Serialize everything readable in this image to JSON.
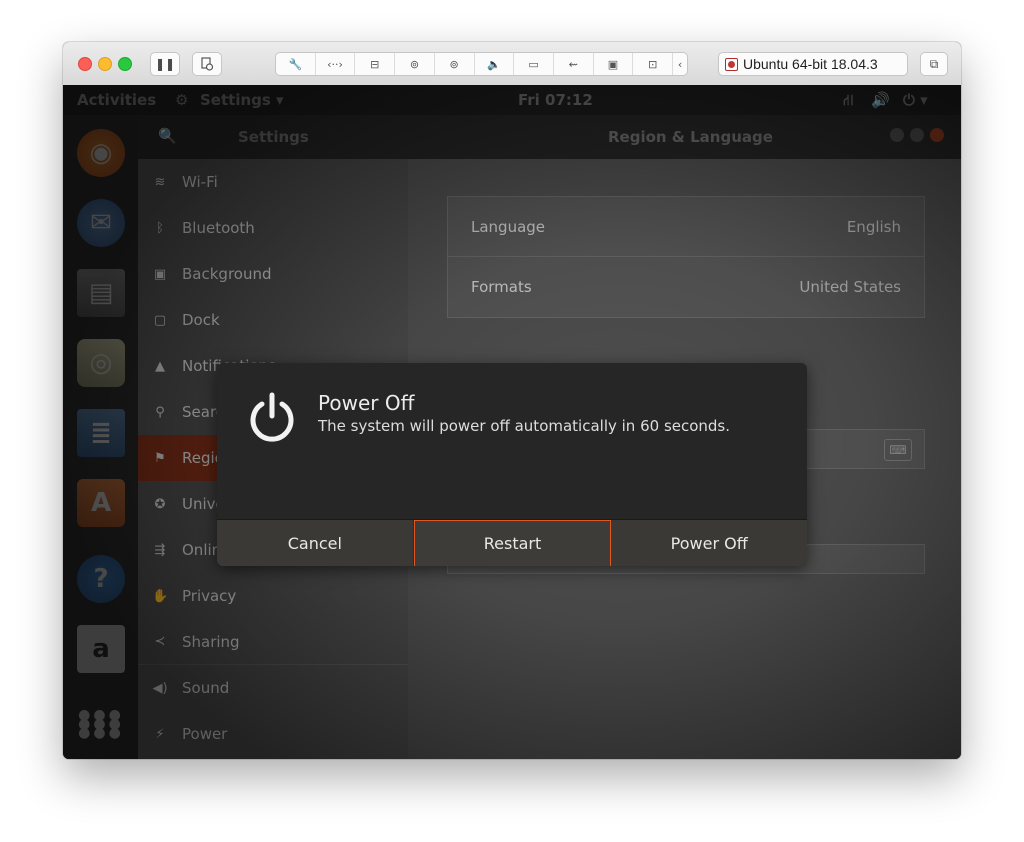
{
  "mac_toolbar": {
    "vm_title": "Ubuntu 64-bit 18.04.3"
  },
  "topbar": {
    "activities": "Activities",
    "app_menu": "Settings ▾",
    "clock": "Fri 07:12"
  },
  "settings": {
    "header_title": "Settings",
    "panel_title": "Region & Language",
    "sidebar_items": [
      {
        "label": "Wi-Fi",
        "icon": "wifi-icon"
      },
      {
        "label": "Bluetooth",
        "icon": "bluetooth-icon"
      },
      {
        "label": "Background",
        "icon": "background-icon"
      },
      {
        "label": "Dock",
        "icon": "dock-icon"
      },
      {
        "label": "Notifications",
        "icon": "bell-icon"
      },
      {
        "label": "Search",
        "icon": "search-icon"
      },
      {
        "label": "Region & Language",
        "icon": "region-icon"
      },
      {
        "label": "Universal Access",
        "icon": "accessibility-icon"
      },
      {
        "label": "Online Accounts",
        "icon": "online-accounts-icon"
      },
      {
        "label": "Privacy",
        "icon": "privacy-icon"
      },
      {
        "label": "Sharing",
        "icon": "sharing-icon"
      },
      {
        "label": "Sound",
        "icon": "sound-icon"
      },
      {
        "label": "Power",
        "icon": "power-icon"
      }
    ],
    "language_label": "Language",
    "language_value": "English",
    "formats_label": "Formats",
    "formats_value": "United States"
  },
  "dialog": {
    "title": "Power Off",
    "message": "The system will power off automatically in 60 seconds.",
    "cancel_label": "Cancel",
    "restart_label": "Restart",
    "poweroff_label": "Power Off"
  },
  "colors": {
    "accent": "#e2561f",
    "dialog_bg": "#262626"
  }
}
